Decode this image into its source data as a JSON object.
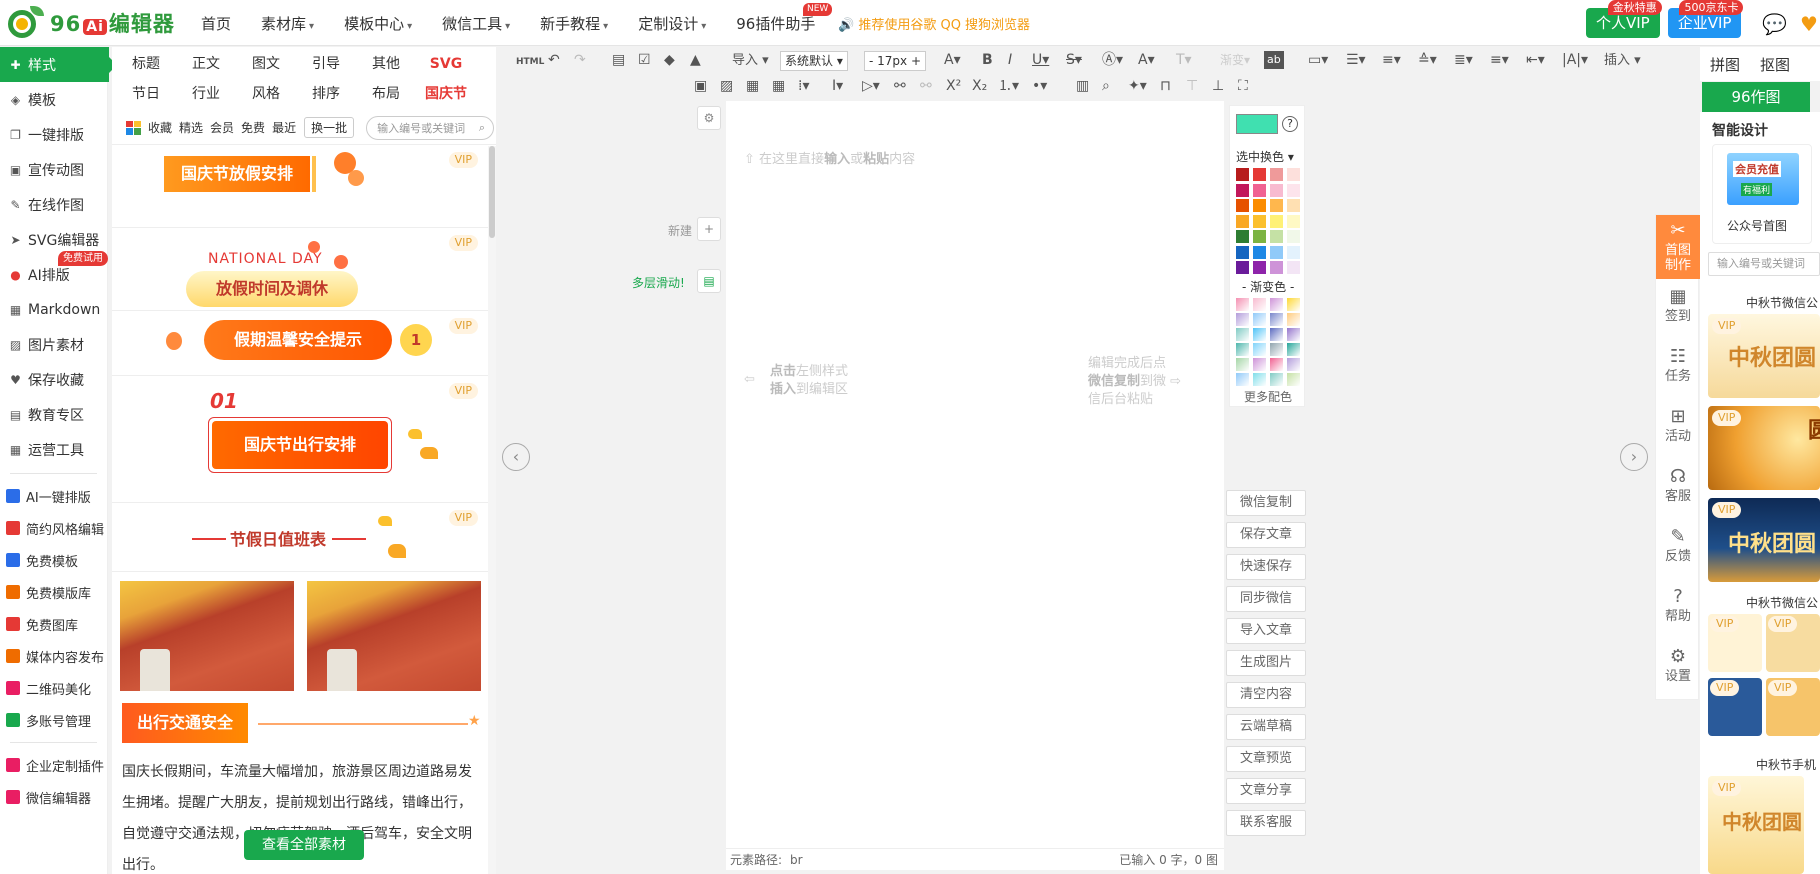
{
  "topbar": {
    "logo_text": "96",
    "logo_ai": "Ai",
    "logo_suffix": "编辑器",
    "nav": [
      {
        "label": "首页",
        "caret": false
      },
      {
        "label": "素材库",
        "caret": true
      },
      {
        "label": "模板中心",
        "caret": true
      },
      {
        "label": "微信工具",
        "caret": true
      },
      {
        "label": "新手教程",
        "caret": true
      },
      {
        "label": "定制设计",
        "caret": true
      },
      {
        "label": "96插件助手",
        "caret": false,
        "badge": "NEW"
      }
    ],
    "promo": "推荐使用谷歌 QQ 搜狗浏览器",
    "vip_personal": "个人VIP",
    "vip_personal_badge": "金秋特惠",
    "vip_enterprise": "企业VIP",
    "vip_enterprise_badge": "500京东卡"
  },
  "sidebar": {
    "items": [
      {
        "label": "样式",
        "icon": "puzzle-icon",
        "active": true
      },
      {
        "label": "模板",
        "icon": "layers-icon"
      },
      {
        "label": "一键排版",
        "icon": "copy-icon"
      },
      {
        "label": "宣传动图",
        "icon": "gif-icon"
      },
      {
        "label": "在线作图",
        "icon": "edit-icon"
      },
      {
        "label": "SVG编辑器",
        "icon": "cursor-icon"
      },
      {
        "label": "AI排版",
        "icon": "ai-icon",
        "tag": "免费试用"
      },
      {
        "label": "Markdown",
        "icon": "grid-icon"
      },
      {
        "label": "图片素材",
        "icon": "image-icon"
      },
      {
        "label": "保存收藏",
        "icon": "heart-icon"
      },
      {
        "label": "教育专区",
        "icon": "book-icon"
      },
      {
        "label": "运营工具",
        "icon": "apps-icon"
      }
    ],
    "tools": [
      {
        "label": "AI一键排版",
        "color": "#2b6de8"
      },
      {
        "label": "简约风格编辑",
        "color": "#e53935"
      },
      {
        "label": "免费模板",
        "color": "#2b6de8"
      },
      {
        "label": "免费模版库",
        "color": "#ef6c00"
      },
      {
        "label": "免费图库",
        "color": "#e53935"
      },
      {
        "label": "媒体内容发布",
        "color": "#ef6c00"
      },
      {
        "label": "二维码美化",
        "color": "#e91e63"
      },
      {
        "label": "多账号管理",
        "color": "#19a84d"
      }
    ],
    "extras": [
      {
        "label": "企业定制插件",
        "color": "#e91e63"
      },
      {
        "label": "微信编辑器",
        "color": "#e91e63"
      }
    ]
  },
  "stylepanel": {
    "categories_row1": [
      "标题",
      "正文",
      "图文",
      "引导",
      "其他",
      "SVG"
    ],
    "categories_row2": [
      "节日",
      "行业",
      "风格",
      "排序",
      "布局",
      "国庆节"
    ],
    "filters": [
      "收藏",
      "精选",
      "会员",
      "免费",
      "最近"
    ],
    "swap_label": "换一批",
    "search_placeholder": "输入编号或关键词",
    "items": {
      "holiday_schedule": "国庆节放假安排",
      "national_day": "NATIONAL DAY",
      "holiday_time": "放假时间及调休",
      "safety_tips": "假期温馨安全提示",
      "safety_num": "1",
      "trip_num": "01",
      "trip": "国庆节出行安排",
      "duty": "节假日值班表",
      "traffic": "出行交通安全",
      "body": "国庆长假期间，车流量大幅增加，旅游景区周边道路易发生拥堵。提醒广大朋友，提前规划出行路线，错峰出行，自觉遵守交通法规，切勿疲劳驾驶、酒后驾车，安全文明出行。",
      "vip": "VIP"
    },
    "view_all": "查看全部素材"
  },
  "toolbar": {
    "import": "导入",
    "font": "系统默认",
    "size": "17px",
    "insert": "插入"
  },
  "editor": {
    "hint_top_a": "在这里直接",
    "hint_top_b": "输入",
    "hint_top_c": "或",
    "hint_top_d": "粘贴",
    "hint_top_e": "内容",
    "new": "新建",
    "multi": "多层滑动!",
    "left_hint_1a": "点击",
    "left_hint_1b": "左侧样式",
    "left_hint_2a": "插入",
    "left_hint_2b": "到编辑区",
    "right_hint_1": "编辑完成后点",
    "right_hint_2a": "微信复制",
    "right_hint_2b": "到微",
    "right_hint_3": "信后台粘贴",
    "path_label": "元素路径:",
    "path_value": "br",
    "count": "已输入 0 字，0 图"
  },
  "colorpanel": {
    "current": "#40e0b0",
    "pick_label": "选中换色",
    "gradient_label": "- 渐变色 -",
    "more": "更多配色",
    "solid": [
      "#b71c1c",
      "#e53935",
      "#ef9a9a",
      "#fde0dc",
      "#c2185b",
      "#f06292",
      "#f8bbd0",
      "#fde4ec",
      "#e65100",
      "#fb8c00",
      "#ffb74d",
      "#ffe0b2",
      "#f9a825",
      "#fbc02d",
      "#fff176",
      "#fff9c4",
      "#2e7d32",
      "#7cb342",
      "#c5e1a5",
      "#f1f8e9",
      "#1565c0",
      "#1e88e5",
      "#90caf9",
      "#e3f2fd",
      "#6a1b9a",
      "#8e24aa",
      "#ce93d8",
      "#f3e5f5"
    ],
    "gradient": [
      "#f48fb1",
      "#f8bbd0",
      "#ce93d8",
      "#fdd835",
      "#b39ddb",
      "#90caf9",
      "#7986cb",
      "#ffcc80",
      "#80cbc4",
      "#4fc3f7",
      "#5c6bc0",
      "#9575cd",
      "#4db6ac",
      "#81d4fa",
      "#90a4ae",
      "#26a69a",
      "#a5d6a7",
      "#ce93d8",
      "#f06292",
      "#b39ddb",
      "#90caf9",
      "#80deea",
      "#80cbc4",
      "#c5e1a5"
    ]
  },
  "actions": [
    "微信复制",
    "保存文章",
    "快速保存",
    "同步微信",
    "导入文章",
    "生成图片",
    "清空内容",
    "云端草稿",
    "文章预览",
    "文章分享",
    "联系客服"
  ],
  "right": {
    "tabs": [
      "拼图",
      "抠图"
    ],
    "btn96": "96作图",
    "smart": "智能设计",
    "card_label": "公众号首图",
    "card_title_a": "会员充值",
    "card_title_b": "有福利",
    "search_placeholder": "输入编号或关键词",
    "section1": "中秋节微信公",
    "section2": "中秋节微信公",
    "section3": "中秋节手机",
    "thumb_vip": "VIP",
    "thumb_text1": "中秋团圆",
    "thumb_text2": "中秋团圆",
    "menu": [
      {
        "label": "首图制作",
        "icon": "tools-icon",
        "active": true
      },
      {
        "label": "签到",
        "icon": "calendar-icon"
      },
      {
        "label": "任务",
        "icon": "task-icon"
      },
      {
        "label": "活动",
        "icon": "gift-icon"
      },
      {
        "label": "客服",
        "icon": "headset-icon"
      },
      {
        "label": "反馈",
        "icon": "feedback-icon"
      },
      {
        "label": "帮助",
        "icon": "help-icon"
      },
      {
        "label": "设置",
        "icon": "settings-icon"
      }
    ]
  }
}
